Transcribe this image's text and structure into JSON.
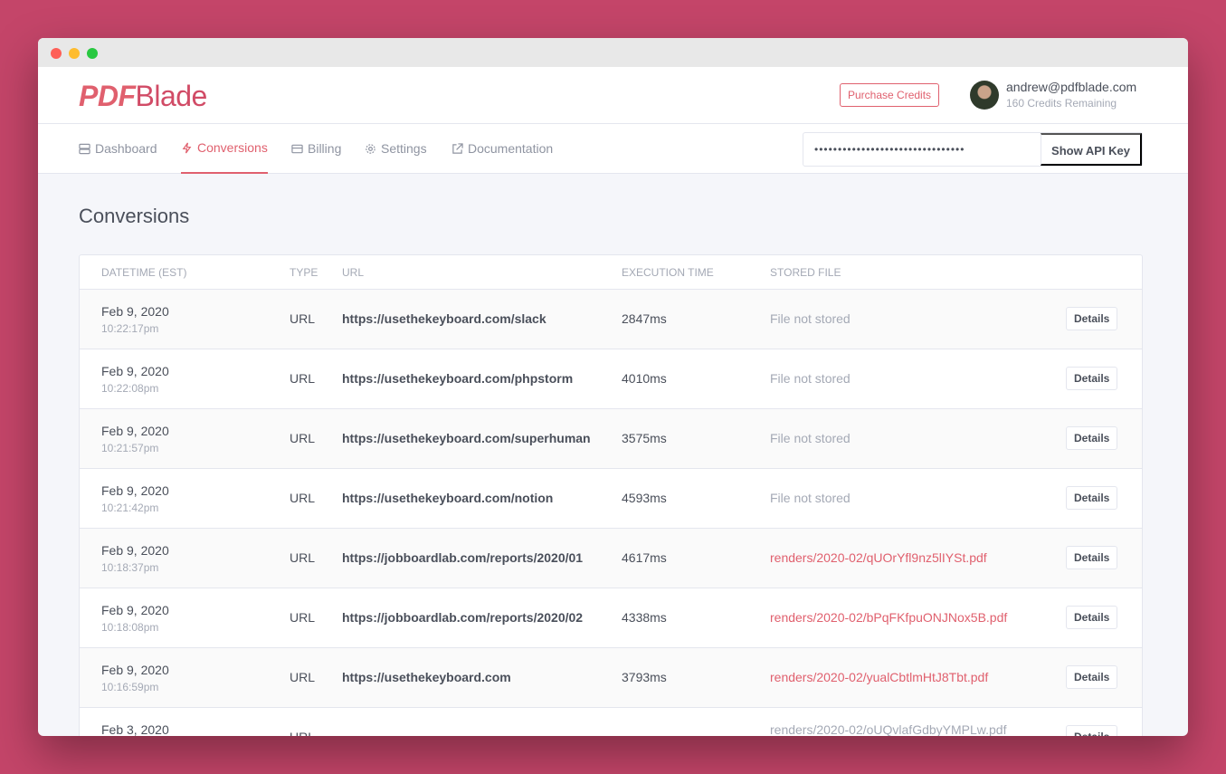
{
  "app": {
    "logo_bold": "PDF",
    "logo_light": "Blade"
  },
  "header": {
    "purchase_label": "Purchase Credits",
    "email": "andrew@pdfblade.com",
    "credits": "160 Credits Remaining"
  },
  "nav": [
    {
      "label": "Dashboard",
      "icon": "server-icon"
    },
    {
      "label": "Conversions",
      "icon": "bolt-icon"
    },
    {
      "label": "Billing",
      "icon": "credit-card-icon"
    },
    {
      "label": "Settings",
      "icon": "gear-icon"
    },
    {
      "label": "Documentation",
      "icon": "external-link-icon"
    }
  ],
  "api": {
    "masked": "••••••••••••••••••••••••••••••••",
    "button": "Show API Key"
  },
  "page_title": "Conversions",
  "table": {
    "headers": [
      "Datetime (EST)",
      "Type",
      "URL",
      "Execution Time",
      "Stored File"
    ],
    "details_label": "Details",
    "rows": [
      {
        "date": "Feb 9, 2020",
        "time": "10:22:17pm",
        "type": "URL",
        "url": "https://usethekeyboard.com/slack",
        "exec": "2847ms",
        "file": "File not stored",
        "stored": false
      },
      {
        "date": "Feb 9, 2020",
        "time": "10:22:08pm",
        "type": "URL",
        "url": "https://usethekeyboard.com/phpstorm",
        "exec": "4010ms",
        "file": "File not stored",
        "stored": false
      },
      {
        "date": "Feb 9, 2020",
        "time": "10:21:57pm",
        "type": "URL",
        "url": "https://usethekeyboard.com/superhuman",
        "exec": "3575ms",
        "file": "File not stored",
        "stored": false
      },
      {
        "date": "Feb 9, 2020",
        "time": "10:21:42pm",
        "type": "URL",
        "url": "https://usethekeyboard.com/notion",
        "exec": "4593ms",
        "file": "File not stored",
        "stored": false
      },
      {
        "date": "Feb 9, 2020",
        "time": "10:18:37pm",
        "type": "URL",
        "url": "https://jobboardlab.com/reports/2020/01",
        "exec": "4617ms",
        "file": "renders/2020-02/qUOrYfl9nz5lIYSt.pdf",
        "stored": true
      },
      {
        "date": "Feb 9, 2020",
        "time": "10:18:08pm",
        "type": "URL",
        "url": "https://jobboardlab.com/reports/2020/02",
        "exec": "4338ms",
        "file": "renders/2020-02/bPqFKfpuONJNox5B.pdf",
        "stored": true
      },
      {
        "date": "Feb 9, 2020",
        "time": "10:16:59pm",
        "type": "URL",
        "url": "https://usethekeyboard.com",
        "exec": "3793ms",
        "file": "renders/2020-02/yualCbtlmHtJ8Tbt.pdf",
        "stored": true
      },
      {
        "date": "Feb 3, 2020",
        "time": "",
        "type": "URL",
        "url": "",
        "exec": "",
        "file": "renders/2020-02/oUQvlafGdbyYMPLw.pdf",
        "stored": false
      }
    ]
  }
}
